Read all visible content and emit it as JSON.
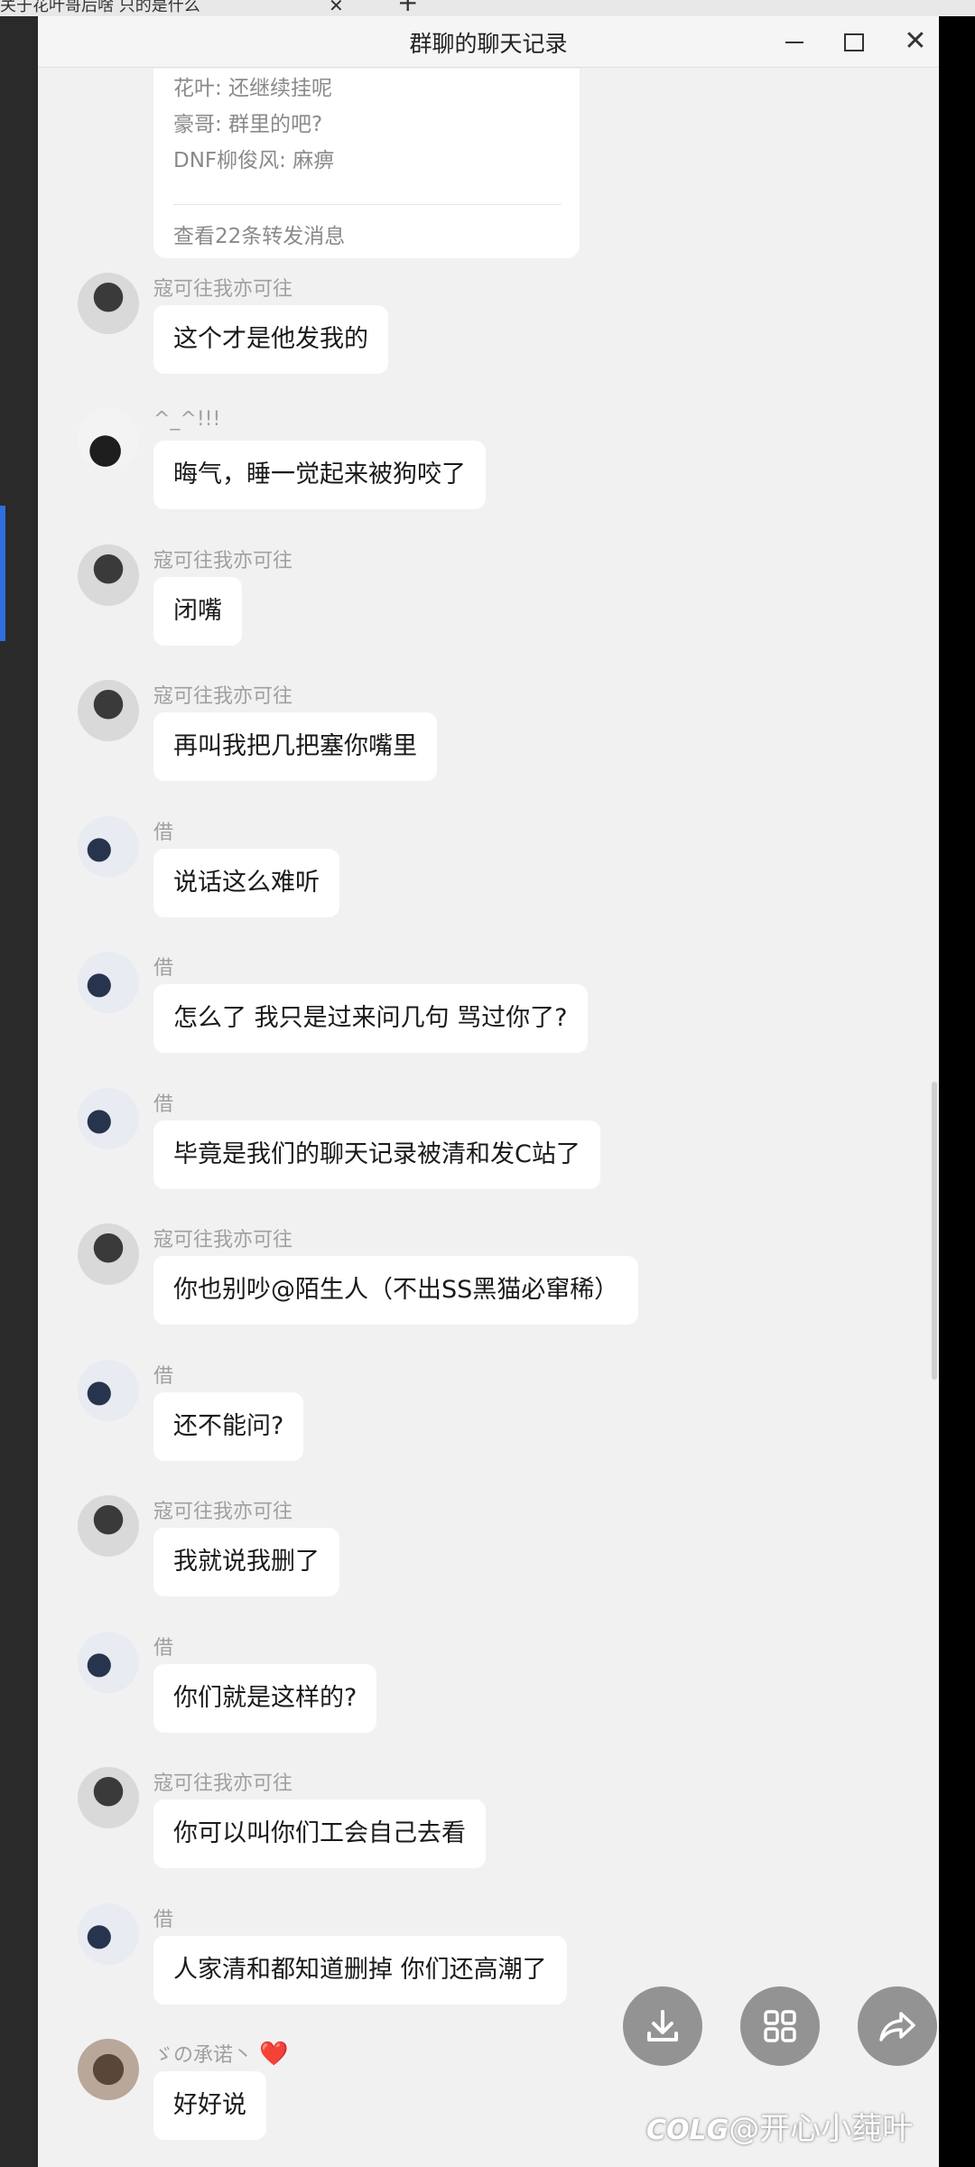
{
  "background": {
    "tab_text": "关于花叶哥后啥 只的是什么",
    "tab_close": "✕",
    "tab_plus": "+"
  },
  "window": {
    "title": "群聊的聊天记录"
  },
  "forwarded": {
    "lines": [
      "花叶: 还继续挂呢",
      "豪哥: 群里的吧?",
      "DNF柳俊风: 麻痹"
    ],
    "footer": "查看22条转发消息"
  },
  "messages": [
    {
      "sender": "寇可往我亦可往",
      "text": "这个才是他发我的"
    },
    {
      "sender": "^_^!!!",
      "text": "晦气，睡一觉起来被狗咬了"
    },
    {
      "sender": "寇可往我亦可往",
      "text": "闭嘴"
    },
    {
      "sender": "寇可往我亦可往",
      "text": "再叫我把几把塞你嘴里"
    },
    {
      "sender": "借",
      "text": "说话这么难听"
    },
    {
      "sender": "借",
      "text": "怎么了 我只是过来问几句 骂过你了?"
    },
    {
      "sender": "借",
      "text": "毕竟是我们的聊天记录被清和发C站了"
    },
    {
      "sender": "寇可往我亦可往",
      "text": "你也别吵@陌生人（不出SS黑猫必窜稀）"
    },
    {
      "sender": "借",
      "text": "还不能问?"
    },
    {
      "sender": "寇可往我亦可往",
      "text": "我就说我删了"
    },
    {
      "sender": "借",
      "text": "你们就是这样的?"
    },
    {
      "sender": "寇可往我亦可往",
      "text": "你可以叫你们工会自己去看"
    },
    {
      "sender": "借",
      "text": "人家清和都知道删掉  你们还高潮了"
    },
    {
      "sender": "ゞの承诺丶",
      "sender_suffix": "❤️",
      "text": "好好说"
    }
  ],
  "watermark": {
    "logo": "COLG",
    "text": "@开心小莼叶"
  },
  "actions": {
    "download": "download-icon",
    "grid": "grid-icon",
    "share": "share-icon"
  }
}
